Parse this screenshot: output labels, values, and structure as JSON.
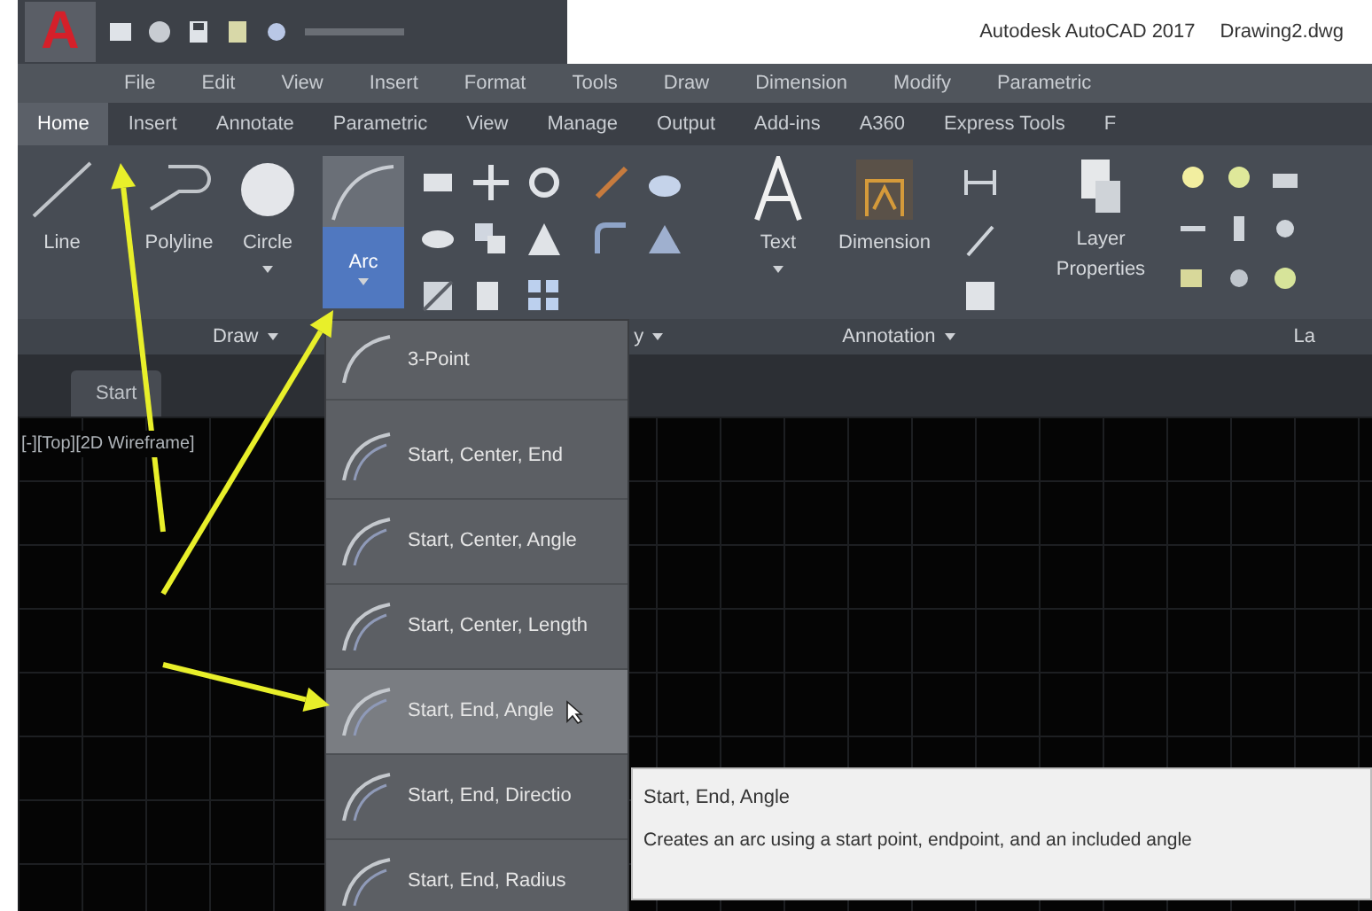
{
  "title_bar": {
    "logo": "A",
    "app": "Autodesk AutoCAD 2017",
    "document": "Drawing2.dwg"
  },
  "menu_bar": [
    "File",
    "Edit",
    "View",
    "Insert",
    "Format",
    "Tools",
    "Draw",
    "Dimension",
    "Modify",
    "Parametric"
  ],
  "ribbon_tabs": [
    {
      "label": "Home",
      "selected": true
    },
    {
      "label": "Insert",
      "selected": false
    },
    {
      "label": "Annotate",
      "selected": false
    },
    {
      "label": "Parametric",
      "selected": false
    },
    {
      "label": "View",
      "selected": false
    },
    {
      "label": "Manage",
      "selected": false
    },
    {
      "label": "Output",
      "selected": false
    },
    {
      "label": "Add-ins",
      "selected": false
    },
    {
      "label": "A360",
      "selected": false
    },
    {
      "label": "Express Tools",
      "selected": false
    },
    {
      "label": "F",
      "selected": false
    }
  ],
  "ribbon": {
    "draw_tools": [
      {
        "label": "Line",
        "kind": "line",
        "selected": false
      },
      {
        "label": "Polyline",
        "kind": "polyline",
        "selected": false
      },
      {
        "label": "Circle",
        "kind": "circle",
        "selected": false
      }
    ],
    "arc_button": {
      "label": "Arc",
      "selected": true
    },
    "annotation_tools": [
      {
        "label": "Text",
        "kind": "text"
      },
      {
        "label": "Dimension",
        "kind": "dimension"
      }
    ],
    "layer_tool": {
      "label": "Layer Properties"
    },
    "panels": [
      "Draw",
      "y",
      "Annotation",
      "La"
    ]
  },
  "file_tabs": [
    {
      "label": "Start"
    }
  ],
  "viewport_label": "[-][Top][2D Wireframe]",
  "arc_menu": [
    {
      "label": "3-Point",
      "selected": false
    },
    {
      "label": "Start, Center, End",
      "selected": false
    },
    {
      "label": "Start, Center, Angle",
      "selected": false
    },
    {
      "label": "Start, Center, Length",
      "selected": false
    },
    {
      "label": "Start, End, Angle",
      "selected": true
    },
    {
      "label": "Start, End, Directio",
      "selected": false
    },
    {
      "label": "Start, End, Radius",
      "selected": false
    }
  ],
  "tooltip": {
    "title": "Start, End, Angle",
    "description": "Creates an arc using a start point, endpoint, and an included angle"
  }
}
